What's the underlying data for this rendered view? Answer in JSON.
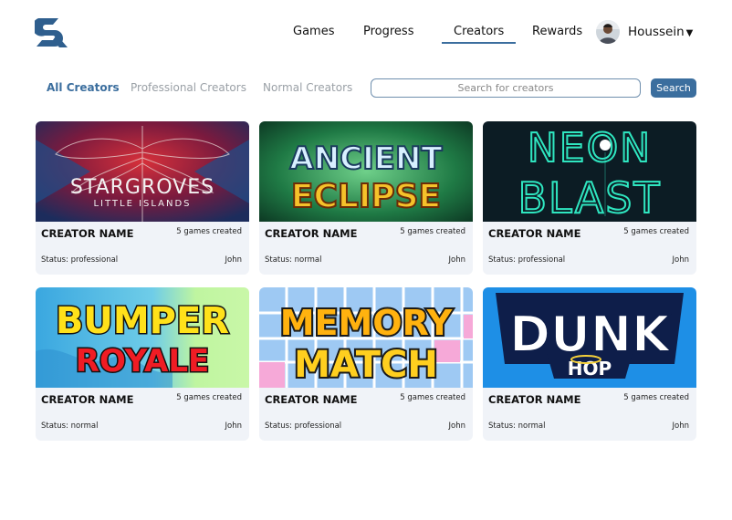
{
  "nav": {
    "items": [
      {
        "label": "Games"
      },
      {
        "label": "Progress"
      },
      {
        "label": "Creators"
      },
      {
        "label": "Rewards"
      }
    ],
    "active": "Creators",
    "user": {
      "name": "Houssein"
    }
  },
  "filters": {
    "tabs": [
      {
        "label": "All Creators"
      },
      {
        "label": "Professional Creators"
      },
      {
        "label": "Normal Creators"
      }
    ],
    "active": "All Creators"
  },
  "search": {
    "placeholder": "Search for creators",
    "button_label": "Search"
  },
  "colors": {
    "accent": "#3b6e9e",
    "card_bg": "#f0f3f8"
  },
  "cards": [
    {
      "game_title": "STARGROVES",
      "game_subtitle": "LITTLE ISLANDS",
      "name": "CREATOR NAME",
      "count": "5 games created",
      "status": "Status: professional",
      "user": "John"
    },
    {
      "game_title": "ANCIENT",
      "game_subtitle": "ECLIPSE",
      "name": "CREATOR NAME",
      "count": "5 games created",
      "status": "Status: normal",
      "user": "John"
    },
    {
      "game_title": "NEON",
      "game_subtitle": "BLAST",
      "name": "CREATOR NAME",
      "count": "5 games created",
      "status": "Status: professional",
      "user": "John"
    },
    {
      "game_title": "BUMPER",
      "game_subtitle": "ROYALE",
      "name": "CREATOR NAME",
      "count": "5 games created",
      "status": "Status: normal",
      "user": "John"
    },
    {
      "game_title": "MEMORY",
      "game_subtitle": "MATCH",
      "name": "CREATOR NAME",
      "count": "5 games created",
      "status": "Status: professional",
      "user": "John"
    },
    {
      "game_title": "DUNK",
      "game_subtitle": "HOP",
      "name": "CREATOR NAME",
      "count": "5 games created",
      "status": "Status: normal",
      "user": "John"
    }
  ]
}
